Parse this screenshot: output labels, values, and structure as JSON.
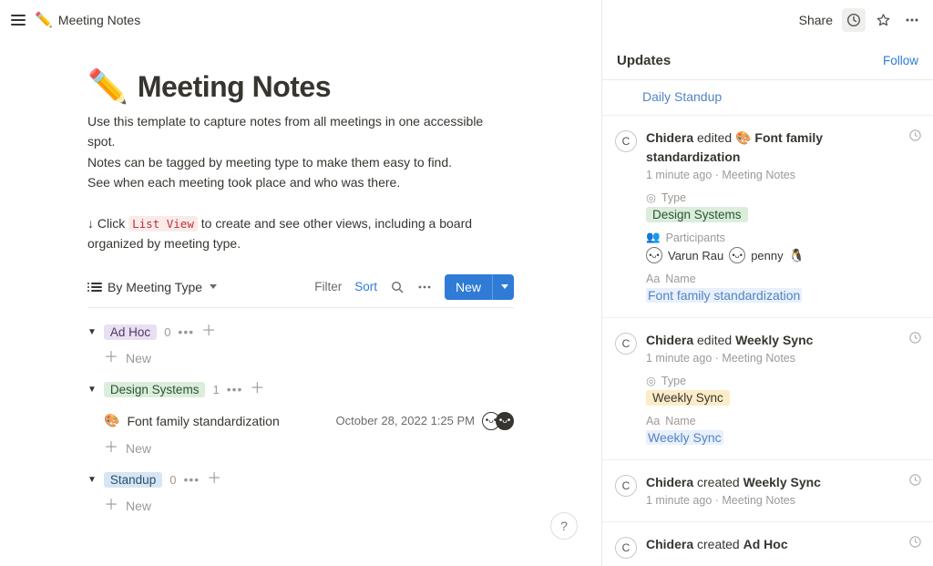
{
  "breadcrumb": {
    "emoji": "✏️",
    "title": "Meeting Notes"
  },
  "page": {
    "emoji": "✏️",
    "title": "Meeting Notes",
    "desc_line1": "Use this template to capture notes from all meetings in one accessible spot.",
    "desc_line2": "Notes can be tagged by meeting type to make them easy to find.",
    "desc_line3": "See when each meeting took place and who was there.",
    "desc2_pre": "↓ Click ",
    "desc2_code": "List View",
    "desc2_post": " to create and see other views, including a board organized by meeting type."
  },
  "db": {
    "view_name": "By Meeting Type",
    "filter": "Filter",
    "sort": "Sort",
    "new": "New",
    "new_row": "New"
  },
  "groups": {
    "adhoc": {
      "label": "Ad Hoc",
      "count": "0"
    },
    "design": {
      "label": "Design Systems",
      "count": "1"
    },
    "standup": {
      "label": "Standup",
      "count": "0"
    }
  },
  "row": {
    "icon": "🎨",
    "title": "Font family standardization",
    "date": "October 28, 2022 1:25 PM"
  },
  "topright": {
    "share": "Share"
  },
  "updates": {
    "heading": "Updates",
    "follow": "Follow",
    "daily_link": "Daily Standup"
  },
  "feed": {
    "e1": {
      "avatar": "C",
      "actor": "Chidera",
      "verb": "edited",
      "icon": "🎨",
      "target": "Font family standardization",
      "time": "1 minute ago",
      "context": "Meeting Notes",
      "type_label": "Type",
      "type_value": "Design Systems",
      "participants_label": "Participants",
      "participant1": "Varun Rau",
      "participant2": "penny",
      "name_label": "Name",
      "name_value": "Font family standardization"
    },
    "e2": {
      "avatar": "C",
      "actor": "Chidera",
      "verb": "edited",
      "target": "Weekly Sync",
      "time": "1 minute ago",
      "context": "Meeting Notes",
      "type_label": "Type",
      "type_value": "Weekly Sync",
      "name_label": "Name",
      "name_value": "Weekly Sync"
    },
    "e3": {
      "avatar": "C",
      "actor": "Chidera",
      "verb": "created",
      "target": "Weekly Sync",
      "time": "1 minute ago",
      "context": "Meeting Notes"
    },
    "e4": {
      "avatar": "C",
      "actor": "Chidera",
      "verb": "created",
      "target": "Ad Hoc"
    }
  }
}
